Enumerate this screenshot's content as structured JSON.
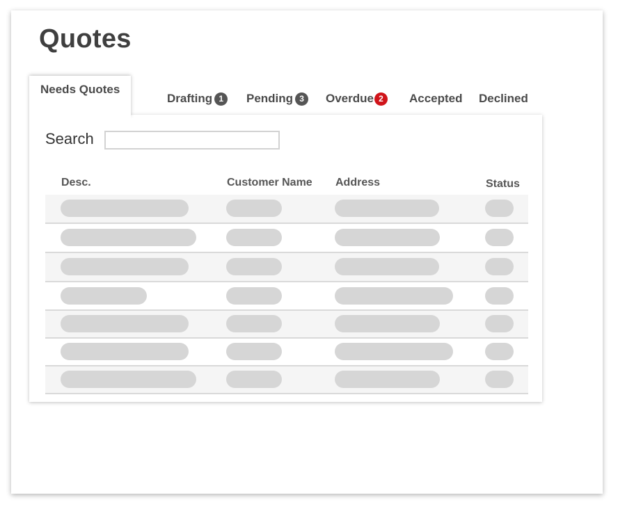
{
  "page": {
    "title": "Quotes"
  },
  "tabs": [
    {
      "label": "Needs Quotes",
      "active": true
    },
    {
      "label": "Drafting",
      "badge": "1",
      "badge_color": "#555555"
    },
    {
      "label": "Pending",
      "badge": "3",
      "badge_color": "#555555"
    },
    {
      "label": "Overdue",
      "badge": "2",
      "badge_color": "#d0141a"
    },
    {
      "label": "Accepted"
    },
    {
      "label": "Declined"
    }
  ],
  "search": {
    "label": "Search",
    "value": "",
    "placeholder": ""
  },
  "table": {
    "columns": [
      "Desc.",
      "Customer Name",
      "Address",
      "Status"
    ],
    "rows_shown_as_placeholders": 7
  },
  "colors": {
    "placeholder_pill": "#d6d6d6",
    "row_alt": "#f5f5f5",
    "badge_dark": "#555555",
    "badge_alert": "#d0141a"
  }
}
